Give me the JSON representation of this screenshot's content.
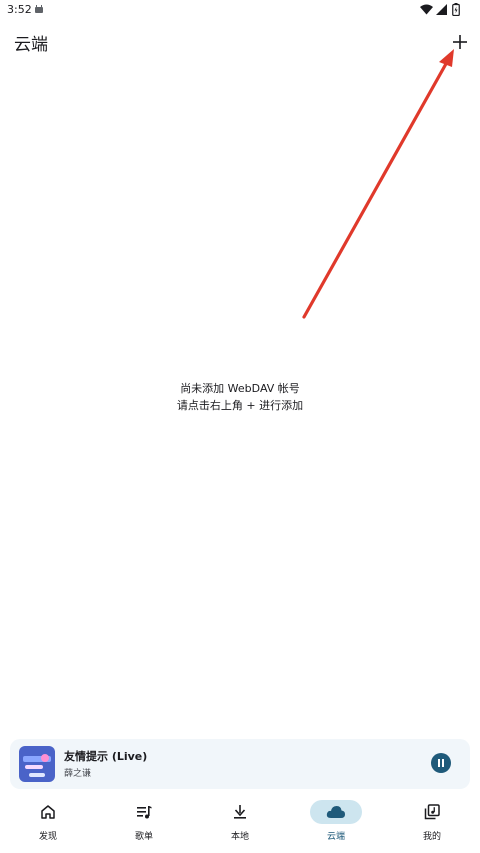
{
  "status_bar": {
    "time": "3:52"
  },
  "app_bar": {
    "title": "云端",
    "add_icon": "plus-icon"
  },
  "empty_state": {
    "line1": "尚未添加 WebDAV 帐号",
    "line2": "请点击右上角 + 进行添加"
  },
  "mini_player": {
    "title": "友情提示 (Live)",
    "artist": "薛之谦",
    "state": "playing",
    "control_icon": "pause-icon"
  },
  "bottom_nav": {
    "items": [
      {
        "label": "发现",
        "icon": "home-icon",
        "active": false
      },
      {
        "label": "歌单",
        "icon": "playlist-icon",
        "active": false
      },
      {
        "label": "本地",
        "icon": "download-icon",
        "active": false
      },
      {
        "label": "云端",
        "icon": "cloud-icon",
        "active": true
      },
      {
        "label": "我的",
        "icon": "library-icon",
        "active": false
      }
    ]
  },
  "colors": {
    "accent": "#1f5a7a",
    "nav_active_bg": "#cde5ef",
    "player_bg": "#f1f6fa",
    "annotation_arrow": "#e0392b"
  }
}
